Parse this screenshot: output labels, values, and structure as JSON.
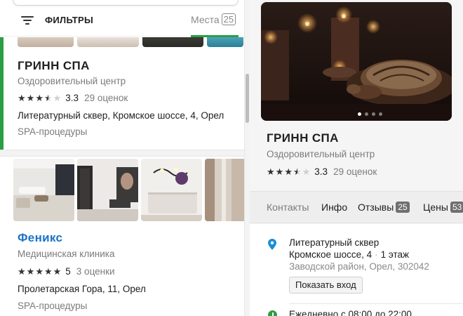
{
  "list_panel": {
    "filters_label": "ФИЛЬТРЫ",
    "places_tab": {
      "label": "Места",
      "count": "25"
    },
    "cards": [
      {
        "title": "ГРИНН СПА",
        "subtitle": "Оздоровительный центр",
        "rating": "3.3",
        "rating_count": "29 оценок",
        "address": "Литературный сквер, Кромское шоссе, 4, Орел",
        "category": "SPA-процедуры"
      },
      {
        "title": "Феникс",
        "subtitle": "Медицинская клиника",
        "rating": "5",
        "rating_count": "3 оценки",
        "address": "Пролетарская Гора, 11, Орел",
        "category": "SPA-процедуры"
      }
    ]
  },
  "detail_panel": {
    "title": "ГРИНН СПА",
    "subtitle": "Оздоровительный центр",
    "rating": "3.3",
    "rating_count": "29 оценок",
    "tabs": [
      {
        "label": "Контакты"
      },
      {
        "label": "Инфо"
      },
      {
        "label": "Отзывы",
        "badge": "25"
      },
      {
        "label": "Цены",
        "badge": "53"
      }
    ],
    "address": {
      "line1": "Литературный сквер",
      "line2_street": "Кромское шоссе, 4",
      "line2_floor": "1 этаж",
      "line3": "Заводской район, Орел, 302042"
    },
    "entrance_button": "Показать вход",
    "hours": "Ежедневно с 08:00 до 22:00"
  },
  "colors": {
    "accent_green": "#2b9e44",
    "link_blue": "#1a73c7"
  }
}
